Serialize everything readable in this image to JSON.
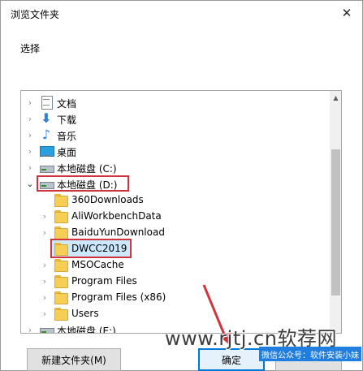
{
  "window": {
    "title": "浏览文件夹",
    "close_glyph": "✕"
  },
  "prompt": "选择",
  "tree": {
    "items": [
      {
        "label": "文档",
        "icon": "document-icon",
        "chevron": "›"
      },
      {
        "label": "下载",
        "icon": "download-icon",
        "chevron": "›"
      },
      {
        "label": "音乐",
        "icon": "music-icon",
        "chevron": "›"
      },
      {
        "label": "桌面",
        "icon": "desktop-icon",
        "chevron": "›"
      },
      {
        "label": "本地磁盘 (C:)",
        "icon": "drive-icon",
        "chevron": "›"
      },
      {
        "label": "本地磁盘 (D:)",
        "icon": "drive-icon",
        "chevron": "⌄",
        "expanded": true
      },
      {
        "label": "360Downloads",
        "icon": "folder-icon",
        "chevron": ""
      },
      {
        "label": "AliWorkbenchData",
        "icon": "folder-icon",
        "chevron": "›"
      },
      {
        "label": "BaiduYunDownload",
        "icon": "folder-icon",
        "chevron": "›"
      },
      {
        "label": "DWCC2019",
        "icon": "folder-icon",
        "chevron": "",
        "selected": true
      },
      {
        "label": "MSOCache",
        "icon": "folder-icon",
        "chevron": "›"
      },
      {
        "label": "Program Files",
        "icon": "folder-icon",
        "chevron": "›"
      },
      {
        "label": "Program Files (x86)",
        "icon": "folder-icon",
        "chevron": "›"
      },
      {
        "label": "Users",
        "icon": "folder-icon",
        "chevron": "›"
      },
      {
        "label": "本地磁盘 (E:)",
        "icon": "drive-icon",
        "chevron": "›"
      }
    ]
  },
  "buttons": {
    "new_folder": "新建文件夹(M)",
    "ok": "确定",
    "cancel": ""
  },
  "overlay": {
    "watermark": "www.rjtj.cn软荐网",
    "wechat": "微信公众号：软件安装小妹"
  },
  "colors": {
    "highlight": "#d0343c",
    "accent": "#0078d7"
  }
}
